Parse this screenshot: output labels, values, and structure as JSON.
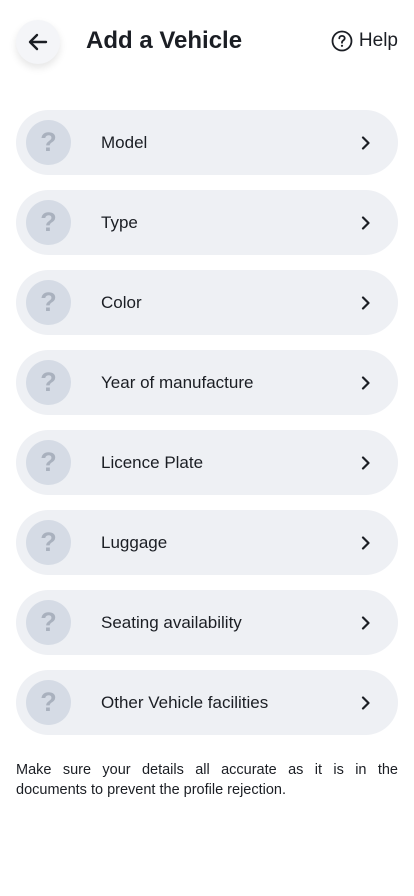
{
  "header": {
    "title": "Add a Vehicle",
    "help_label": "Help",
    "back_icon": "arrow-left-icon",
    "help_icon": "question-circle-icon"
  },
  "items": [
    {
      "label": "Model",
      "icon": "question-mark-icon"
    },
    {
      "label": "Type",
      "icon": "question-mark-icon"
    },
    {
      "label": "Color",
      "icon": "question-mark-icon"
    },
    {
      "label": "Year of manufacture",
      "icon": "question-mark-icon"
    },
    {
      "label": "Licence Plate",
      "icon": "question-mark-icon"
    },
    {
      "label": "Luggage",
      "icon": "question-mark-icon"
    },
    {
      "label": "Seating availability",
      "icon": "question-mark-icon"
    },
    {
      "label": "Other Vehicle facilities",
      "icon": "question-mark-icon"
    }
  ],
  "placeholder_glyph": "?",
  "note": "Make sure your details all accurate as it is in the documents to prevent the profile rejection.",
  "colors": {
    "row_background": "#eef0f4",
    "icon_circle": "#d5dbe5",
    "icon_glyph": "#a9b1be",
    "text": "#1b1e24"
  }
}
